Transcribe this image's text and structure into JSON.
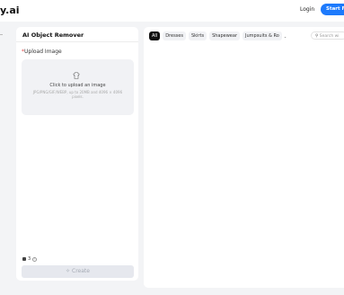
{
  "header": {
    "logo_text": "y.ai",
    "login_label": "Login",
    "start_label": "Start For Free"
  },
  "tool_panel": {
    "title": "AI Object Remover",
    "upload_label": "Upload Image",
    "required_mark": "*",
    "upload_prompt": "Click to upload an image",
    "upload_hint": "JPG/PNG/GIF/WEBP, up to 20MB and 4096 × 4096 pixels.",
    "credits_value": "3",
    "create_label": "Create"
  },
  "gallery": {
    "tabs": [
      {
        "label": "All",
        "active": true
      },
      {
        "label": "Dresses",
        "active": false
      },
      {
        "label": "Skirts",
        "active": false
      },
      {
        "label": "Shapewear",
        "active": false
      },
      {
        "label": "Jumpsuits & Ro",
        "active": false
      }
    ],
    "search_placeholder": "Search wi"
  },
  "colors": {
    "accent": "#1d7afc",
    "page_bg": "#f3f4f6",
    "active_tab": "#111111"
  }
}
